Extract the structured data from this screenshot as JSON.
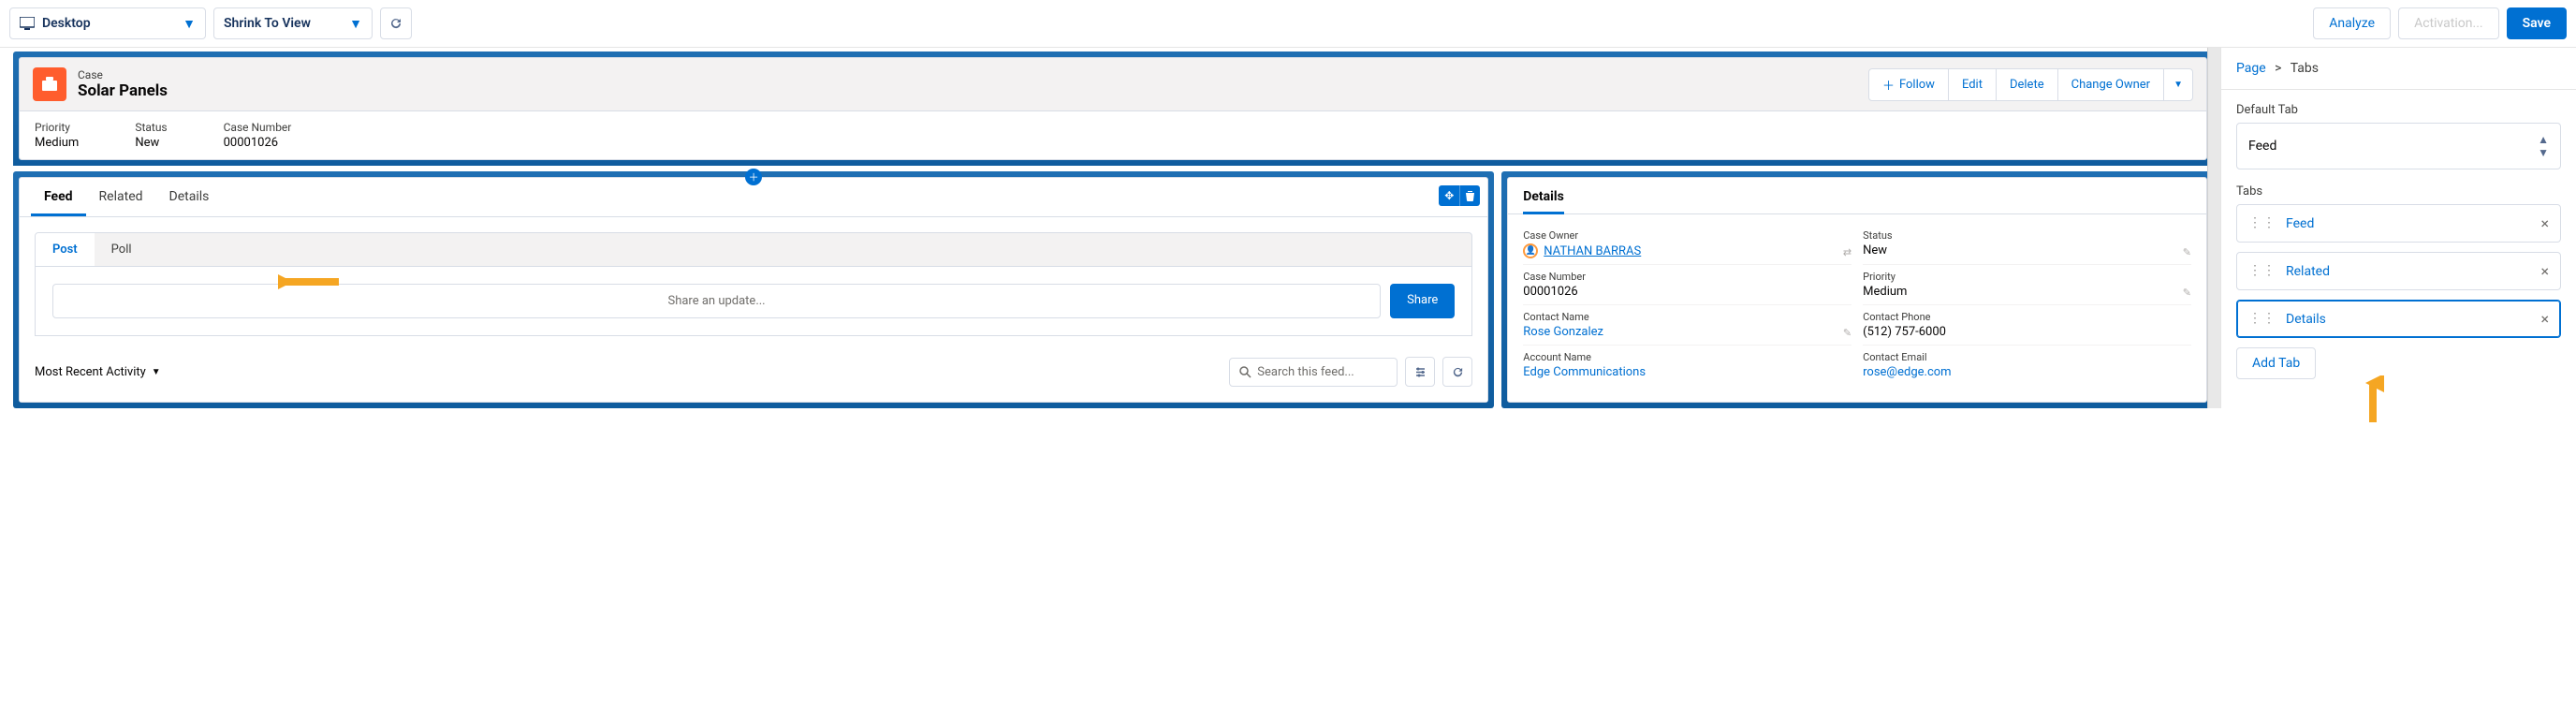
{
  "topbar": {
    "device": "Desktop",
    "zoom": "Shrink To View",
    "analyze": "Analyze",
    "activation": "Activation...",
    "save": "Save"
  },
  "record": {
    "type_label": "Case",
    "title": "Solar Panels",
    "actions": {
      "follow": "Follow",
      "edit": "Edit",
      "delete": "Delete",
      "change_owner": "Change Owner"
    },
    "fields": {
      "priority_label": "Priority",
      "priority": "Medium",
      "status_label": "Status",
      "status": "New",
      "casenum_label": "Case Number",
      "casenum": "00001026"
    }
  },
  "tabs": {
    "feed": "Feed",
    "related": "Related",
    "details": "Details"
  },
  "feed": {
    "post": "Post",
    "poll": "Poll",
    "placeholder": "Share an update...",
    "share": "Share",
    "mra": "Most Recent Activity",
    "search_placeholder": "Search this feed..."
  },
  "details_panel": {
    "title": "Details",
    "owner_label": "Case Owner",
    "owner": "NATHAN BARRAS",
    "status_label": "Status",
    "status": "New",
    "casenum_label": "Case Number",
    "casenum": "00001026",
    "priority_label": "Priority",
    "priority": "Medium",
    "contactname_label": "Contact Name",
    "contactname": "Rose Gonzalez",
    "contactphone_label": "Contact Phone",
    "contactphone": "(512) 757-6000",
    "accountname_label": "Account Name",
    "accountname": "Edge Communications",
    "contactemail_label": "Contact Email",
    "contactemail": "rose@edge.com"
  },
  "sidebar": {
    "crumb_page": "Page",
    "crumb_tabs": "Tabs",
    "default_tab_label": "Default Tab",
    "default_tab": "Feed",
    "tabs_label": "Tabs",
    "items": [
      {
        "label": "Feed"
      },
      {
        "label": "Related"
      },
      {
        "label": "Details"
      }
    ],
    "add_tab": "Add Tab"
  }
}
